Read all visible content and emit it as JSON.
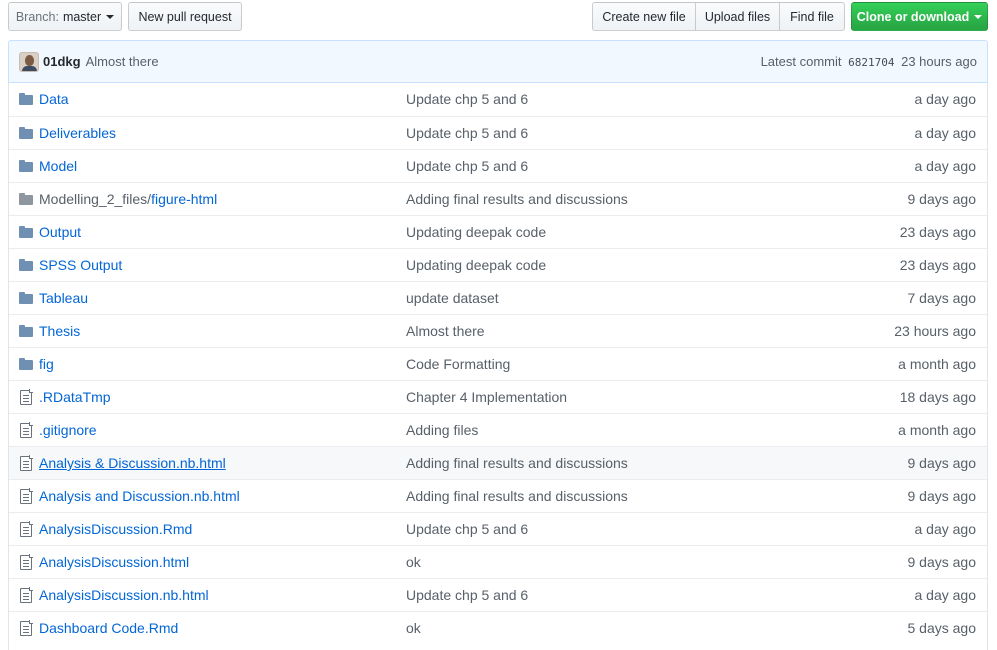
{
  "toolbar": {
    "branch_prefix": "Branch:",
    "branch_name": "master",
    "new_pull_request": "New pull request",
    "create_new_file": "Create new file",
    "upload_files": "Upload files",
    "find_file": "Find file",
    "clone_or_download": "Clone or download"
  },
  "latest_commit": {
    "author": "01dkg",
    "message": "Almost there",
    "label": "Latest commit",
    "sha": "6821704",
    "age": "23 hours ago"
  },
  "files": [
    {
      "type": "dir",
      "name": "Data",
      "message": "Update chp 5 and 6",
      "age": "a day ago"
    },
    {
      "type": "dir",
      "name": "Deliverables",
      "message": "Update chp 5 and 6",
      "age": "a day ago"
    },
    {
      "type": "dir",
      "name": "Model",
      "message": "Update chp 5 and 6",
      "age": "a day ago"
    },
    {
      "type": "dir",
      "name_prefix": "Modelling_2_files/",
      "name": "figure-html",
      "message": "Adding final results and discussions",
      "age": "9 days ago"
    },
    {
      "type": "dir",
      "name": "Output",
      "message": "Updating deepak code",
      "age": "23 days ago"
    },
    {
      "type": "dir",
      "name": "SPSS Output",
      "message": "Updating deepak code",
      "age": "23 days ago"
    },
    {
      "type": "dir",
      "name": "Tableau",
      "message": "update dataset",
      "age": "7 days ago"
    },
    {
      "type": "dir",
      "name": "Thesis",
      "message": "Almost there",
      "age": "23 hours ago"
    },
    {
      "type": "dir",
      "name": "fig",
      "message": "Code Formatting",
      "age": "a month ago"
    },
    {
      "type": "file",
      "name": ".RDataTmp",
      "message": "Chapter 4 Implementation",
      "age": "18 days ago"
    },
    {
      "type": "file",
      "name": ".gitignore",
      "message": "Adding files",
      "age": "a month ago"
    },
    {
      "type": "file",
      "name": "Analysis & Discussion.nb.html",
      "message": "Adding final results and discussions",
      "age": "9 days ago",
      "hovered": true
    },
    {
      "type": "file",
      "name": "Analysis and Discussion.nb.html",
      "message": "Adding final results and discussions",
      "age": "9 days ago"
    },
    {
      "type": "file",
      "name": "AnalysisDiscussion.Rmd",
      "message": "Update chp 5 and 6",
      "age": "a day ago"
    },
    {
      "type": "file",
      "name": "AnalysisDiscussion.html",
      "message": "ok",
      "age": "9 days ago"
    },
    {
      "type": "file",
      "name": "AnalysisDiscussion.nb.html",
      "message": "Update chp 5 and 6",
      "age": "a day ago"
    },
    {
      "type": "file",
      "name": "Dashboard Code.Rmd",
      "message": "ok",
      "age": "5 days ago"
    }
  ],
  "colors": {
    "link": "#0366d6",
    "muted": "#586069",
    "commit_bar_bg": "#f1f8ff",
    "commit_bar_border": "#c8e1ff",
    "green_button": "#28a745",
    "folder": "#79b8ff"
  },
  "icons": {
    "dir": "folder-icon",
    "file": "file-text-icon"
  }
}
